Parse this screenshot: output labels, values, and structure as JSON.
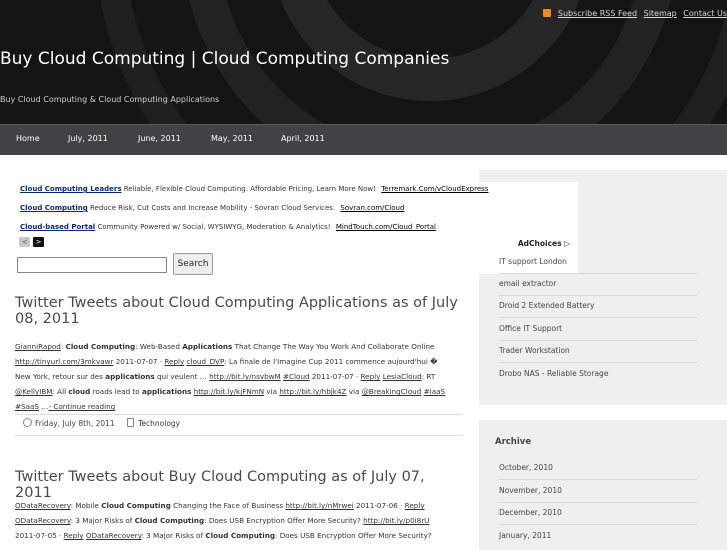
{
  "header": {
    "rss_label": "Subscribe RSS Feed",
    "sitemap_label": "Sitemap",
    "contact_label": "Contact Us",
    "site_title": "Buy Cloud Computing | Cloud Computing Companies",
    "site_description": "Buy Cloud Computing & Cloud Computing Applications"
  },
  "nav": [
    {
      "label": "Home"
    },
    {
      "label": "July, 2011"
    },
    {
      "label": "June, 2011"
    },
    {
      "label": "May, 2011"
    },
    {
      "label": "April, 2011"
    }
  ],
  "ads": [
    {
      "title": "Cloud Computing Leaders",
      "text": "Reliable, Flexible Cloud Computing. Affordable Pricing, Learn More Now!",
      "url": "Terremark.Com/vCloudExpress"
    },
    {
      "title": "Cloud Computing",
      "text": "Reduce Risk, Cut Costs and Increase Mobility - Sovran Cloud Services.",
      "url": "Sovran.com/Cloud"
    },
    {
      "title": "Cloud-based Portal",
      "text": "Community Powered w/ Social, WYSIWYG, Moderation & Analytics!",
      "url": "MindTouch.com/Cloud_Portal"
    }
  ],
  "ad_nav": {
    "prev": "<",
    "next": ">"
  },
  "adchoices_label": "AdChoices",
  "adchoices_icon": "▷",
  "search": {
    "button_label": "Search",
    "value": ""
  },
  "posts": [
    {
      "title": "Twitter Tweets about Cloud Computing Applications as of July 08, 2011",
      "lines": [
        [
          [
            "a",
            "GianniRapod"
          ],
          [
            "t",
            ": "
          ],
          [
            "b",
            "Cloud Computing"
          ],
          [
            "t",
            ": Web-Based "
          ],
          [
            "b",
            "Applications"
          ],
          [
            "t",
            " That Change The Way You Work And Collaborate Online"
          ]
        ],
        [
          [
            "a",
            "http://tinyurl.com/3mkvawr"
          ],
          [
            "t",
            " 2011-07-07 · "
          ],
          [
            "a",
            "Reply"
          ],
          [
            "t",
            " "
          ],
          [
            "a",
            "cloud_DVP"
          ],
          [
            "t",
            ": La finale de l'Imagine Cup 2011 commence aujourd'hui �"
          ]
        ],
        [
          [
            "t",
            "New York, retour sur des "
          ],
          [
            "b",
            "applications"
          ],
          [
            "t",
            " qui veulent … "
          ],
          [
            "a",
            "http://bit.ly/nsvbwM"
          ],
          [
            "t",
            " "
          ],
          [
            "a",
            "#Cloud"
          ],
          [
            "t",
            " 2011-07-07 · "
          ],
          [
            "a",
            "Reply"
          ],
          [
            "t",
            " "
          ],
          [
            "a",
            "LesiaCloud"
          ],
          [
            "t",
            ": RT"
          ]
        ],
        [
          [
            "a",
            "@KellyIBM"
          ],
          [
            "t",
            ": All "
          ],
          [
            "b",
            "cloud"
          ],
          [
            "t",
            " roads lead to "
          ],
          [
            "b",
            "applications"
          ],
          [
            "t",
            " "
          ],
          [
            "a",
            "http://bit.ly/kjFNmN"
          ],
          [
            "t",
            " via "
          ],
          [
            "a",
            "http://bit.ly/hbjk4Z"
          ],
          [
            "t",
            " via "
          ],
          [
            "a",
            "@BreakingCloud"
          ],
          [
            "t",
            " "
          ],
          [
            "a",
            "#IaaS"
          ]
        ],
        [
          [
            "a",
            "#SaaS"
          ],
          [
            "t",
            " …"
          ],
          [
            "a",
            "- Continue reading"
          ]
        ]
      ],
      "date": "Friday, July 8th, 2011",
      "category": "Technology"
    },
    {
      "title": "Twitter Tweets about Buy Cloud Computing as of July 07, 2011",
      "lines": [
        [
          [
            "a",
            "ODataRecovery"
          ],
          [
            "t",
            ": Mobile "
          ],
          [
            "b",
            "Cloud Computing"
          ],
          [
            "t",
            " Changing the Face of Business "
          ],
          [
            "a",
            "http://bit.ly/nMrwei"
          ],
          [
            "t",
            " 2011-07-06 · "
          ],
          [
            "a",
            "Reply"
          ]
        ],
        [
          [
            "a",
            "ODataRecovery"
          ],
          [
            "t",
            ": 3 Major Risks of "
          ],
          [
            "b",
            "Cloud Computing"
          ],
          [
            "t",
            ": Does USB Encryption Offer More Security? "
          ],
          [
            "a",
            "http://bit.ly/p0i8rU"
          ]
        ],
        [
          [
            "t",
            "2011-07-05 · "
          ],
          [
            "a",
            "Reply"
          ],
          [
            "t",
            " "
          ],
          [
            "a",
            "ODataRecovery"
          ],
          [
            "t",
            ": 3 Major Risks of "
          ],
          [
            "b",
            "Cloud Computing"
          ],
          [
            "t",
            ": Does USB Encryption Offer More Security?"
          ]
        ]
      ]
    }
  ],
  "sidebar": {
    "links": [
      "IT support London",
      "email extractor",
      "Droid 2 Extended Battery",
      "Office IT Support",
      "Trader Workstation",
      "Drobo NAS - Reliable Storage"
    ],
    "archive_title": "Archive",
    "archive": [
      "October, 2010",
      "November, 2010",
      "December, 2010",
      "January, 2011"
    ]
  },
  "colors": {
    "header_bg": "#141414",
    "nav_bg": "#404244",
    "ad_title": "#0b2a6f",
    "rss": "#f08a1e"
  }
}
